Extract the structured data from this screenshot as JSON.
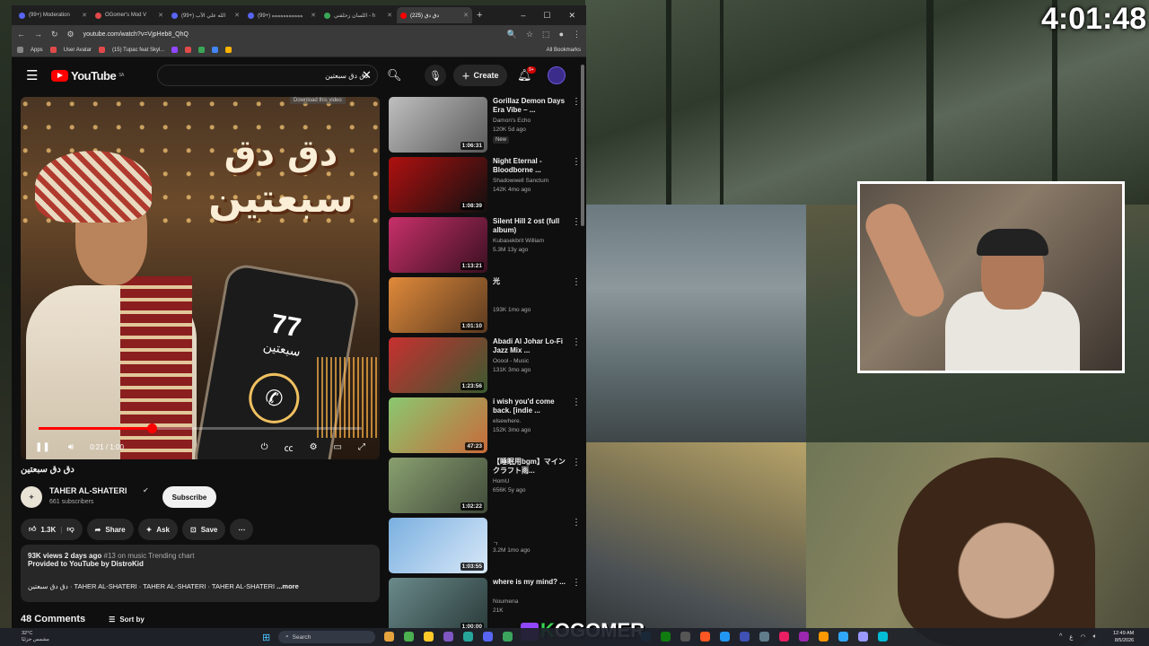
{
  "overlay": {
    "timer": "4:01:48",
    "brand_k": "K",
    "brand": "OGOMER"
  },
  "browser": {
    "tabs": [
      {
        "label": "(99+) Moderation",
        "color": "#5865f2"
      },
      {
        "label": "OGomer's Mod V",
        "color": "#e04a4a"
      },
      {
        "label": "(99+) الله علي الآب",
        "color": "#5865f2"
      },
      {
        "label": "(99+) ەەەەەەەەەەە",
        "color": "#5865f2"
      },
      {
        "label": "اللسان زحلقني - h",
        "color": "#3aa757"
      },
      {
        "label": "(225) دق دق",
        "color": "#ff0000",
        "active": true
      }
    ],
    "new_tab": "+",
    "window_controls": [
      "–",
      "☐",
      "✕"
    ],
    "url": "youtube.com/watch?v=VjpHeb8_QhQ",
    "bookmarks": [
      "Apps",
      "User Avatar",
      "(15) Tupac feat Skyl...",
      "All Bookmarks"
    ]
  },
  "yt_header": {
    "logo": "YouTube",
    "region": "SA",
    "search_query": "دق دق سبعتين",
    "create_label": "Create",
    "notif_count": "9+"
  },
  "player": {
    "art_line1": "دق دق",
    "art_line2": "سبعتين",
    "phone_number": "77",
    "phone_name": "سبعتين",
    "time": "0:21 / 1:00",
    "progress": 0.35,
    "download_hint": "Download this video"
  },
  "video": {
    "title": "دق دق سبعتين",
    "channel": "TAHER AL-SHATERI",
    "verified": "✔",
    "subscribers": "661 subscribers",
    "subscribe_label": "Subscribe",
    "likes": "1.3K",
    "share_label": "Share",
    "ask_label": "Ask",
    "save_label": "Save",
    "views_date": "93K views  2 days ago",
    "trending": "#13 on music Trending chart",
    "provided_by": "Provided to YouTube by DistroKid",
    "tags_line": "دق دق سبعتين · TAHER AL-SHATERI · TAHER AL-SHATERI · TAHER AL-SHATERI",
    "more_label": "...more",
    "comments_count": "48 Comments",
    "sort_label": "Sort by"
  },
  "recommendations": [
    {
      "title": "Gorillaz Demon Days Era Vibe – ...",
      "channel": "Damon's Echo",
      "meta": "120K  5d ago",
      "badge": "New",
      "duration": "1:06:31",
      "thumb": [
        "#bfbfbf",
        "#5a5a5a"
      ]
    },
    {
      "title": "Night Eternal - Bloodborne ...",
      "channel": "Shadowwell Sanctum",
      "meta": "142K  4mo ago",
      "badge": "",
      "duration": "1:08:39",
      "thumb": [
        "#b01010",
        "#101010"
      ]
    },
    {
      "title": "Silent Hill 2 ost (full album)",
      "channel": "Kubasekbrit William",
      "meta": "5.3M  13y ago",
      "badge": "",
      "duration": "1:13:21",
      "thumb": [
        "#c8306a",
        "#3a1020"
      ]
    },
    {
      "title": "光",
      "channel": "",
      "meta": "193K  1mo ago",
      "badge": "",
      "duration": "1:01:10",
      "thumb": [
        "#e08a3a",
        "#5a3a20"
      ]
    },
    {
      "title": "Abadi Al Johar Lo-Fi Jazz Mix ...",
      "channel": "Ooool - Music",
      "meta": "131K  3mo ago",
      "badge": "",
      "duration": "1:23:56",
      "thumb": [
        "#c83030",
        "#3a5a30"
      ]
    },
    {
      "title": "i wish you'd come back. [indie ...",
      "channel": "elsewhere.",
      "meta": "152K  3mo ago",
      "badge": "",
      "duration": "47:23",
      "thumb": [
        "#8ac870",
        "#c86a3a"
      ]
    },
    {
      "title": "【睡眠用bgm】マインクラフト雨...",
      "channel": "HomU",
      "meta": "656K  5y ago",
      "badge": "",
      "duration": "1:02:22",
      "thumb": [
        "#8aa070",
        "#404a3a"
      ]
    },
    {
      "title": "",
      "channel": "ㄱ",
      "meta": "3.2M  1mo ago",
      "badge": "",
      "duration": "1:03:55",
      "thumb": [
        "#7ab0e0",
        "#d8e8f8"
      ]
    },
    {
      "title": "where is my mind? ...",
      "channel": "Noumena",
      "meta": "21K",
      "badge": "",
      "duration": "1:00:00",
      "thumb": [
        "#6a8a8a",
        "#2a3a3a"
      ]
    }
  ],
  "taskbar": {
    "weather_temp": "32°C",
    "weather_desc": "مشمس جزئيًا",
    "search_label": "Search",
    "time": "12:49 AM",
    "date": "8/5/2026",
    "lang": "ع"
  }
}
